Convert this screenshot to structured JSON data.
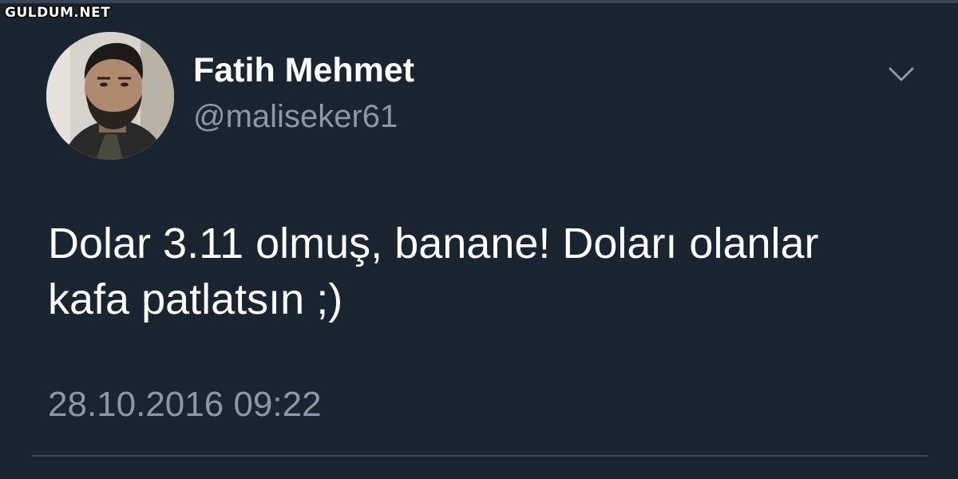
{
  "watermark": "GULDUM.NET",
  "tweet": {
    "author": {
      "display_name": "Fatih Mehmet",
      "handle": "@maliseker61"
    },
    "text": "Dolar 3.11 olmuş, banane! Doları olanlar\nkafa patlatsın ;)",
    "timestamp": "28.10.2016 09:22",
    "menu_icon": "chevron-down-icon"
  },
  "colors": {
    "background": "#1b2431",
    "primary_text": "#ffffff",
    "secondary_text": "#8b98a8"
  }
}
